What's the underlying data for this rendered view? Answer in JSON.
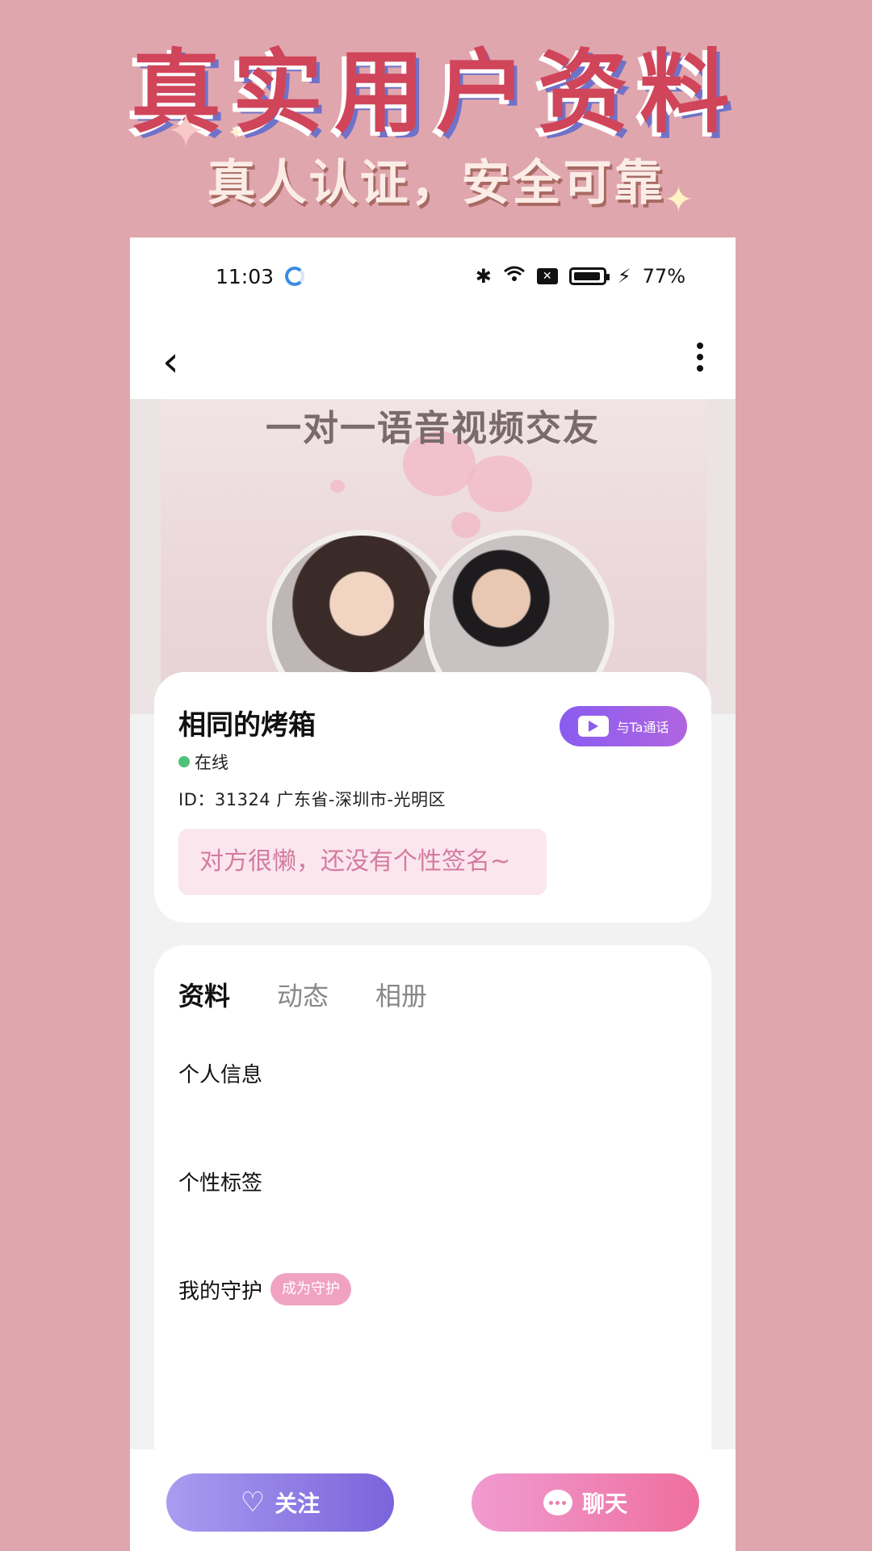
{
  "promo": {
    "title": "真实用户资料",
    "subtitle": "真人认证，安全可靠"
  },
  "status_bar": {
    "time": "11:03",
    "battery": "77%"
  },
  "banner": {
    "title": "一对一语音视频交友"
  },
  "profile": {
    "name": "相同的烤箱",
    "status": "在线",
    "id_line": "ID：31324  广东省-深圳市-光明区",
    "call_button": "与Ta通话",
    "signature": "对方很懒，还没有个性签名~"
  },
  "tabs": [
    {
      "label": "资料"
    },
    {
      "label": "动态"
    },
    {
      "label": "相册"
    }
  ],
  "sections": {
    "personal_info": "个人信息",
    "personal_tags": "个性标签",
    "my_guard": "我的守护",
    "become_guard": "成为守护"
  },
  "bottom": {
    "follow": "关注",
    "chat": "聊天"
  },
  "colors": {
    "background": "#e0a6ad",
    "accent_purple": "#8a5cf0",
    "accent_pink": "#ee6f9e",
    "online_green": "#4fc27a"
  }
}
